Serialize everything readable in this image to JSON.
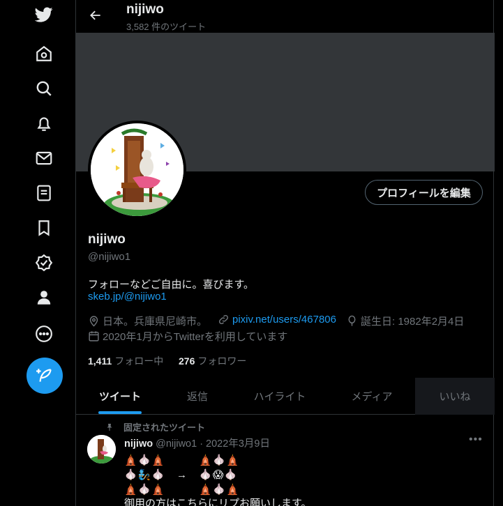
{
  "sidebar": {
    "icons": [
      "twitter-logo-icon",
      "home-icon",
      "explore-icon",
      "notifications-icon",
      "messages-icon",
      "lists-icon",
      "bookmarks-icon",
      "verified-icon",
      "profile-icon",
      "more-icon"
    ],
    "compose_icon": "compose-tweet-icon"
  },
  "header": {
    "name": "nijiwo",
    "tweet_count": "3,582 件のツイート"
  },
  "profile": {
    "edit_button": "プロフィールを編集",
    "name": "nijiwo",
    "handle": "@nijiwo1",
    "bio": "フォローなどご自由に。喜びます。",
    "bio_link": "skeb.jp/@nijiwo1",
    "location": "日本。兵庫県尼崎市。",
    "website": "pixiv.net/users/467806",
    "birthday": "誕生日: 1982年2月4日",
    "joined": "2020年1月からTwitterを利用しています",
    "following_count": "1,411",
    "following_label": "フォロー中",
    "followers_count": "276",
    "followers_label": "フォロワー"
  },
  "tabs": [
    {
      "label": "ツイート",
      "active": true
    },
    {
      "label": "返信"
    },
    {
      "label": "ハイライト"
    },
    {
      "label": "メディア"
    },
    {
      "label": "いいね"
    }
  ],
  "pinned_tweet": {
    "label": "固定されたツイート",
    "name": "nijiwo",
    "meta": "@nijiwo1 · 2022年3月9日",
    "lines": [
      "🛕🧄🛕　　　🛕🧄🛕",
      "🧄🧞🧄　→　🧄😱🧄",
      "🛕🧄🛕　　　🛕🧄🛕",
      "御用の方はこちらにリプお願いします。"
    ]
  },
  "colors": {
    "accent": "#1d9bf0",
    "banner": "#333639",
    "muted": "#71767b"
  }
}
